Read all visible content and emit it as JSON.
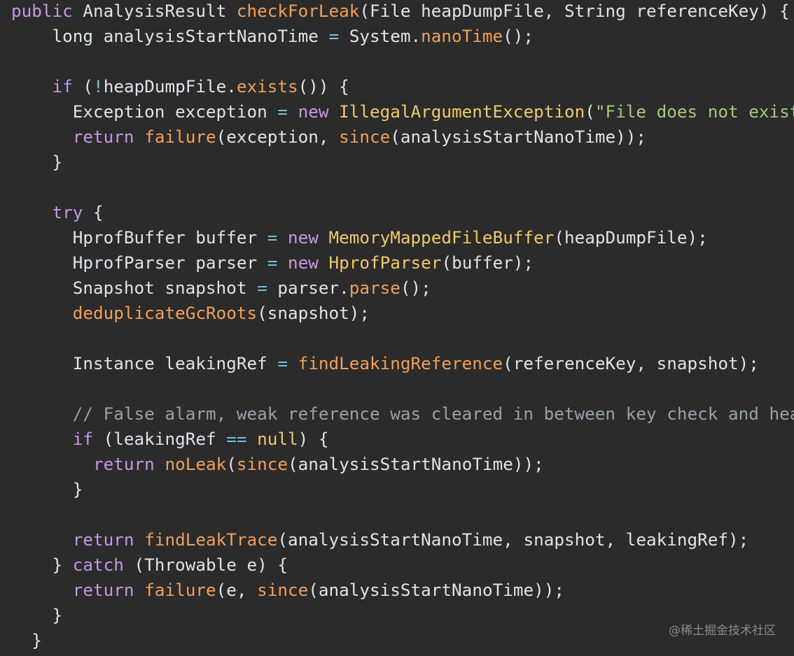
{
  "colors": {
    "background": "#2b2b2b",
    "keyword": "#c697e6",
    "method": "#f0a05a",
    "type": "#f0c96a",
    "string": "#a5c87b",
    "operator": "#79c0e0",
    "comment": "#9aa1ab",
    "plain": "#dfe3ea"
  },
  "code": [
    [
      [
        "kw",
        "public"
      ],
      [
        "tx",
        " AnalysisResult "
      ],
      [
        "fn",
        "checkForLeak"
      ],
      [
        "tx",
        "(File heapDumpFile, String referenceKey) {"
      ]
    ],
    [
      [
        "tx",
        "    long analysisStartNanoTime "
      ],
      [
        "op",
        "="
      ],
      [
        "tx",
        " System."
      ],
      [
        "fn",
        "nanoTime"
      ],
      [
        "tx",
        "();"
      ]
    ],
    [],
    [
      [
        "tx",
        "    "
      ],
      [
        "kw",
        "if"
      ],
      [
        "tx",
        " ("
      ],
      [
        "op",
        "!"
      ],
      [
        "tx",
        "heapDumpFile."
      ],
      [
        "fn",
        "exists"
      ],
      [
        "tx",
        "()) {"
      ]
    ],
    [
      [
        "tx",
        "      Exception exception "
      ],
      [
        "op",
        "="
      ],
      [
        "tx",
        " "
      ],
      [
        "kw",
        "new"
      ],
      [
        "tx",
        " "
      ],
      [
        "ty",
        "IllegalArgumentException"
      ],
      [
        "tx",
        "("
      ],
      [
        "str",
        "\"File does not exist:"
      ]
    ],
    [
      [
        "tx",
        "      "
      ],
      [
        "kw",
        "return"
      ],
      [
        "tx",
        " "
      ],
      [
        "fn",
        "failure"
      ],
      [
        "tx",
        "(exception, "
      ],
      [
        "fn",
        "since"
      ],
      [
        "tx",
        "(analysisStartNanoTime));"
      ]
    ],
    [
      [
        "tx",
        "    }"
      ]
    ],
    [],
    [
      [
        "tx",
        "    "
      ],
      [
        "kw",
        "try"
      ],
      [
        "tx",
        " {"
      ]
    ],
    [
      [
        "tx",
        "      HprofBuffer buffer "
      ],
      [
        "op",
        "="
      ],
      [
        "tx",
        " "
      ],
      [
        "kw",
        "new"
      ],
      [
        "tx",
        " "
      ],
      [
        "ty",
        "MemoryMappedFileBuffer"
      ],
      [
        "tx",
        "(heapDumpFile);"
      ]
    ],
    [
      [
        "tx",
        "      HprofParser parser "
      ],
      [
        "op",
        "="
      ],
      [
        "tx",
        " "
      ],
      [
        "kw",
        "new"
      ],
      [
        "tx",
        " "
      ],
      [
        "ty",
        "HprofParser"
      ],
      [
        "tx",
        "(buffer);"
      ]
    ],
    [
      [
        "tx",
        "      Snapshot snapshot "
      ],
      [
        "op",
        "="
      ],
      [
        "tx",
        " parser."
      ],
      [
        "fn",
        "parse"
      ],
      [
        "tx",
        "();"
      ]
    ],
    [
      [
        "tx",
        "      "
      ],
      [
        "fn",
        "deduplicateGcRoots"
      ],
      [
        "tx",
        "(snapshot);"
      ]
    ],
    [],
    [
      [
        "tx",
        "      Instance leakingRef "
      ],
      [
        "op",
        "="
      ],
      [
        "tx",
        " "
      ],
      [
        "fn",
        "findLeakingReference"
      ],
      [
        "tx",
        "(referenceKey, snapshot);"
      ]
    ],
    [],
    [
      [
        "tx",
        "      "
      ],
      [
        "cm",
        "// False alarm, weak reference was cleared in between key check and heap"
      ]
    ],
    [
      [
        "tx",
        "      "
      ],
      [
        "kw",
        "if"
      ],
      [
        "tx",
        " (leakingRef "
      ],
      [
        "op",
        "=="
      ],
      [
        "tx",
        " "
      ],
      [
        "ty",
        "null"
      ],
      [
        "tx",
        ") {"
      ]
    ],
    [
      [
        "tx",
        "        "
      ],
      [
        "kw",
        "return"
      ],
      [
        "tx",
        " "
      ],
      [
        "fn",
        "noLeak"
      ],
      [
        "tx",
        "("
      ],
      [
        "fn",
        "since"
      ],
      [
        "tx",
        "(analysisStartNanoTime));"
      ]
    ],
    [
      [
        "tx",
        "      }"
      ]
    ],
    [],
    [
      [
        "tx",
        "      "
      ],
      [
        "kw",
        "return"
      ],
      [
        "tx",
        " "
      ],
      [
        "fn",
        "findLeakTrace"
      ],
      [
        "tx",
        "(analysisStartNanoTime, snapshot, leakingRef);"
      ]
    ],
    [
      [
        "tx",
        "    } "
      ],
      [
        "kw",
        "catch"
      ],
      [
        "tx",
        " (Throwable e) {"
      ]
    ],
    [
      [
        "tx",
        "      "
      ],
      [
        "kw",
        "return"
      ],
      [
        "tx",
        " "
      ],
      [
        "fn",
        "failure"
      ],
      [
        "tx",
        "(e, "
      ],
      [
        "fn",
        "since"
      ],
      [
        "tx",
        "(analysisStartNanoTime));"
      ]
    ],
    [
      [
        "tx",
        "    }"
      ]
    ],
    [
      [
        "tx",
        "  }"
      ]
    ]
  ],
  "watermark": "@稀土掘金技术社区"
}
